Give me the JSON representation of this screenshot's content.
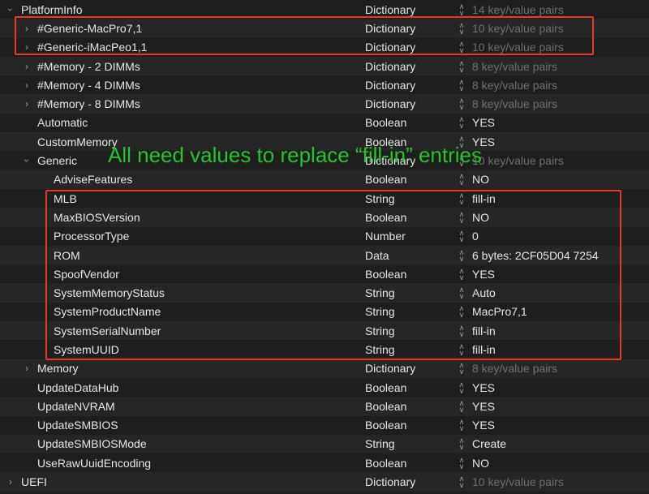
{
  "rows": [
    {
      "key": "PlatformInfo",
      "type": "Dictionary",
      "value": "14 key/value pairs",
      "indent": 0,
      "chev": "down",
      "dim": true
    },
    {
      "key": "#Generic-MacPro7,1",
      "type": "Dictionary",
      "value": "10 key/value pairs",
      "indent": 1,
      "chev": "right",
      "dim": true
    },
    {
      "key": "#Generic-iMacPeo1,1",
      "type": "Dictionary",
      "value": "10 key/value pairs",
      "indent": 1,
      "chev": "right",
      "dim": true
    },
    {
      "key": "#Memory - 2 DIMMs",
      "type": "Dictionary",
      "value": "8 key/value pairs",
      "indent": 1,
      "chev": "right",
      "dim": true
    },
    {
      "key": "#Memory - 4 DIMMs",
      "type": "Dictionary",
      "value": "8 key/value pairs",
      "indent": 1,
      "chev": "right",
      "dim": true
    },
    {
      "key": "#Memory - 8 DIMMs",
      "type": "Dictionary",
      "value": "8 key/value pairs",
      "indent": 1,
      "chev": "right",
      "dim": true
    },
    {
      "key": "Automatic",
      "type": "Boolean",
      "value": "YES",
      "indent": 1,
      "chev": "",
      "dim": false
    },
    {
      "key": "CustomMemory",
      "type": "Boolean",
      "value": "YES",
      "indent": 1,
      "chev": "",
      "dim": false
    },
    {
      "key": "Generic",
      "type": "Dictionary",
      "value": "10 key/value pairs",
      "indent": 1,
      "chev": "down",
      "dim": true
    },
    {
      "key": "AdviseFeatures",
      "type": "Boolean",
      "value": "NO",
      "indent": 2,
      "chev": "",
      "dim": false
    },
    {
      "key": "MLB",
      "type": "String",
      "value": "fill-in",
      "indent": 2,
      "chev": "",
      "dim": false
    },
    {
      "key": "MaxBIOSVersion",
      "type": "Boolean",
      "value": "NO",
      "indent": 2,
      "chev": "",
      "dim": false
    },
    {
      "key": "ProcessorType",
      "type": "Number",
      "value": "0",
      "indent": 2,
      "chev": "",
      "dim": false
    },
    {
      "key": "ROM",
      "type": "Data",
      "value": "6 bytes: 2CF05D04 7254",
      "indent": 2,
      "chev": "",
      "dim": false
    },
    {
      "key": "SpoofVendor",
      "type": "Boolean",
      "value": "YES",
      "indent": 2,
      "chev": "",
      "dim": false
    },
    {
      "key": "SystemMemoryStatus",
      "type": "String",
      "value": "Auto",
      "indent": 2,
      "chev": "",
      "dim": false
    },
    {
      "key": "SystemProductName",
      "type": "String",
      "value": "MacPro7,1",
      "indent": 2,
      "chev": "",
      "dim": false
    },
    {
      "key": "SystemSerialNumber",
      "type": "String",
      "value": "fill-in",
      "indent": 2,
      "chev": "",
      "dim": false
    },
    {
      "key": "SystemUUID",
      "type": "String",
      "value": "fill-in",
      "indent": 2,
      "chev": "",
      "dim": false
    },
    {
      "key": "Memory",
      "type": "Dictionary",
      "value": "8 key/value pairs",
      "indent": 1,
      "chev": "right",
      "dim": true
    },
    {
      "key": "UpdateDataHub",
      "type": "Boolean",
      "value": "YES",
      "indent": 1,
      "chev": "",
      "dim": false
    },
    {
      "key": "UpdateNVRAM",
      "type": "Boolean",
      "value": "YES",
      "indent": 1,
      "chev": "",
      "dim": false
    },
    {
      "key": "UpdateSMBIOS",
      "type": "Boolean",
      "value": "YES",
      "indent": 1,
      "chev": "",
      "dim": false
    },
    {
      "key": "UpdateSMBIOSMode",
      "type": "String",
      "value": "Create",
      "indent": 1,
      "chev": "",
      "dim": false
    },
    {
      "key": "UseRawUuidEncoding",
      "type": "Boolean",
      "value": "NO",
      "indent": 1,
      "chev": "",
      "dim": false
    },
    {
      "key": "UEFI",
      "type": "Dictionary",
      "value": "10 key/value pairs",
      "indent": 0,
      "chev": "right",
      "dim": true
    }
  ],
  "annotation": "All need values to replace “fill-in” entries",
  "colors": {
    "background": "#1e1e1e",
    "highlight_box": "#e23b2a",
    "annotation": "#27c22e"
  }
}
